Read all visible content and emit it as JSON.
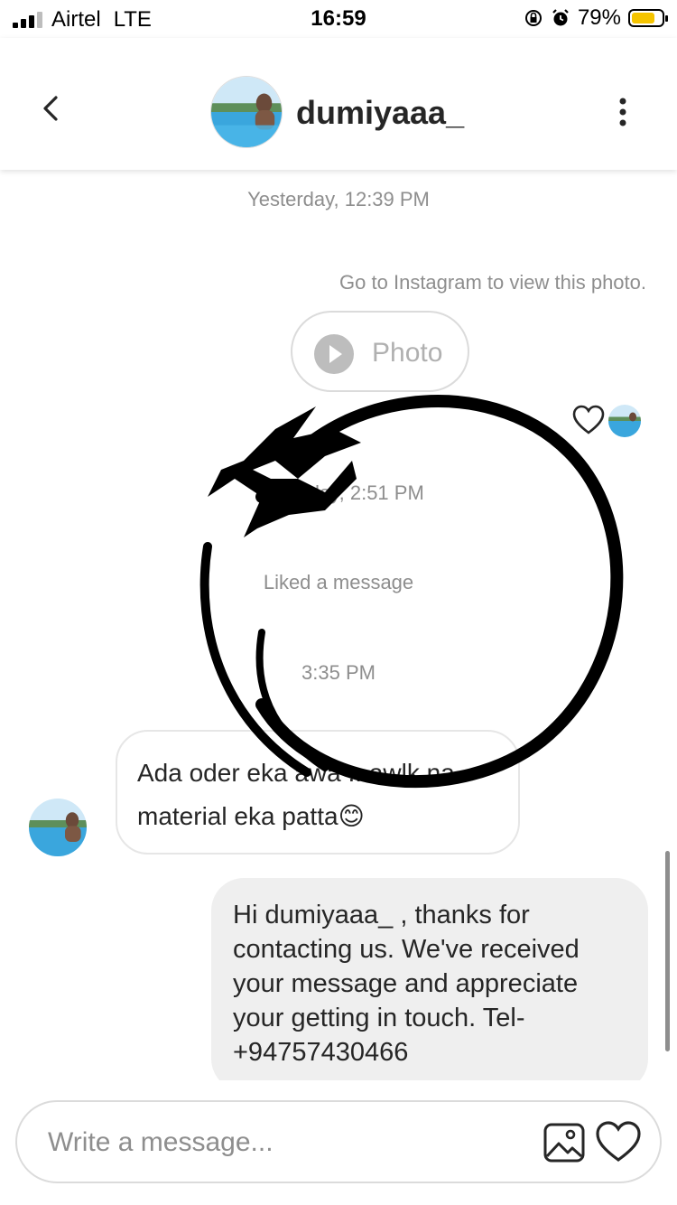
{
  "status_bar": {
    "carrier": "Airtel",
    "network": "LTE",
    "time": "16:59",
    "battery": "79%",
    "battery_level": 0.79
  },
  "header": {
    "username": "dumiyaaa_",
    "back_icon": "chevron-left-icon",
    "more_icon": "more-vertical-icon"
  },
  "messages": {
    "timestamp_1": "Yesterday, 12:39 PM",
    "photo_note": "Go to Instagram to view this photo.",
    "photo_label": "Photo",
    "timestamp_2": "Yesterday, 2:51 PM",
    "liked_message": "Liked a message",
    "timestamp_3": "3:35 PM",
    "incoming_text": "Ada oder eka awa .. awlk na material  eka patta😊",
    "outgoing_text": "Hi dumiyaaa_ , thanks for contacting us. We've received your message and appreciate your getting in touch. Tel-+94757430466"
  },
  "composer": {
    "placeholder": "Write a message...",
    "gallery_icon": "image-icon",
    "heart_icon": "heart-icon"
  },
  "colors": {
    "accent_battery": "#f5c400",
    "bubble_out_bg": "#efefef",
    "muted_text": "#8e8e8e"
  }
}
